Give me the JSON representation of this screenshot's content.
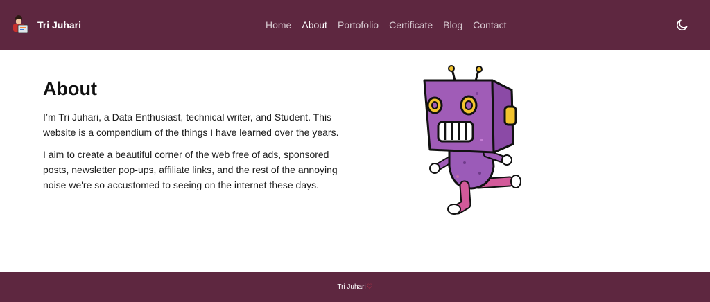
{
  "brand": {
    "name": "Tri Juhari",
    "logo_icon": "developer-avatar-icon"
  },
  "nav": {
    "items": [
      {
        "label": "Home",
        "active": false
      },
      {
        "label": "About",
        "active": true
      },
      {
        "label": "Portofolio",
        "active": false
      },
      {
        "label": "Certificate",
        "active": false
      },
      {
        "label": "Blog",
        "active": false
      },
      {
        "label": "Contact",
        "active": false
      }
    ],
    "theme_toggle_icon": "moon-icon"
  },
  "main": {
    "title": "About",
    "paragraphs": [
      "I’m Tri Juhari, a Data Enthusiast, technical writer, and Student. This website is a compendium of the things I have learned over the years.",
      "I aim to create a beautiful corner of the web free of ads, sponsored posts, newsletter pop-ups, affiliate links, and the rest of the annoying noise we're so accustomed to seeing on the internet these days."
    ],
    "illustration": "running-robot-illustration"
  },
  "footer": {
    "text": "Tri Juhari",
    "heart": "♡",
    "heart_icon": "heart-icon"
  },
  "colors": {
    "brand": "#5e2740",
    "nav_text": "#d6c8cf",
    "active": "#ffffff",
    "robot_body": "#9b5bb8",
    "accent": "#f2c32e",
    "heart": "#ff3b4a"
  }
}
